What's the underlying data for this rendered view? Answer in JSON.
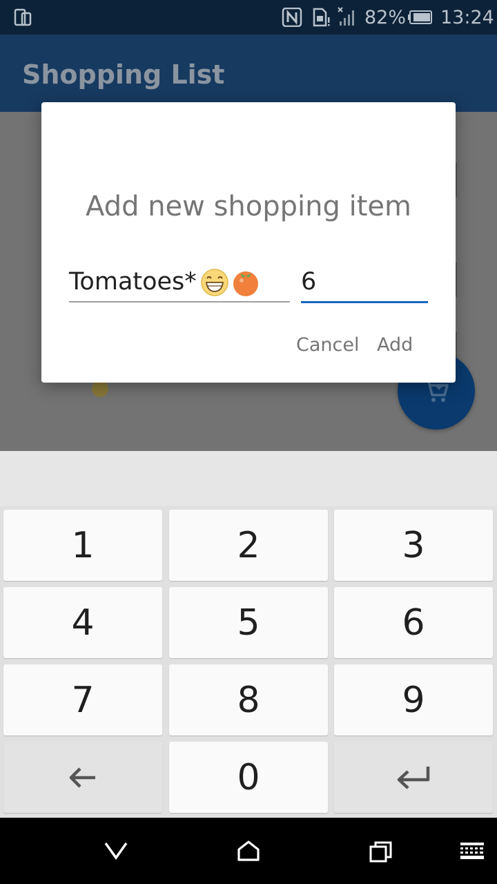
{
  "status_bar": {
    "battery_percent": "82%",
    "time": "13:24"
  },
  "app": {
    "title": "Shopping List"
  },
  "dialog": {
    "title": "Add new shopping item",
    "item_name": "Tomatoes*",
    "quantity": "6",
    "cancel_label": "Cancel",
    "add_label": "Add"
  },
  "keyboard": {
    "keys": [
      "1",
      "2",
      "3",
      "4",
      "5",
      "6",
      "7",
      "8",
      "9",
      "0"
    ]
  },
  "colors": {
    "accent": "#1565c0",
    "app_bar": "#173a60",
    "fab": "#0a3a6e"
  }
}
